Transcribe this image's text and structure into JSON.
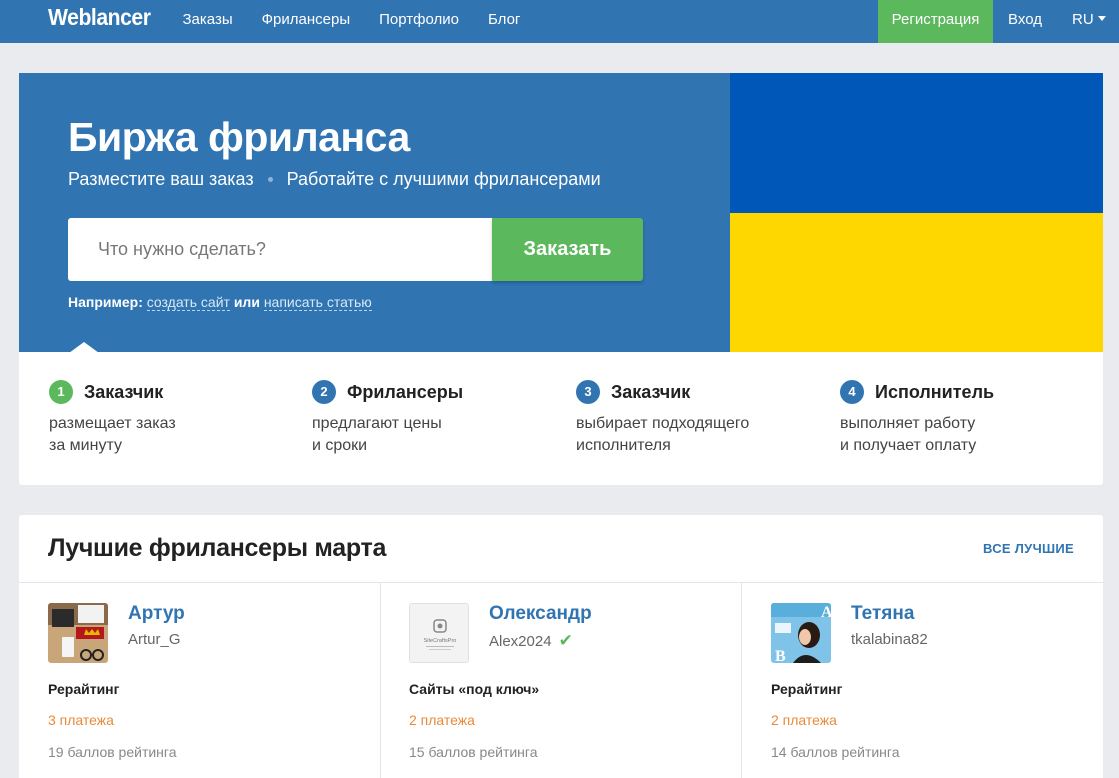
{
  "nav": {
    "logo": "Weblancer",
    "links": [
      "Заказы",
      "Фрилансеры",
      "Портфолио",
      "Блог"
    ],
    "register": "Регистрация",
    "login": "Вход",
    "lang": "RU"
  },
  "hero": {
    "title": "Биржа фриланса",
    "sub1": "Разместите ваш заказ",
    "sub2": "Работайте с лучшими фрилансерами",
    "search_placeholder": "Что нужно сделать?",
    "order_button": "Заказать",
    "example_prefix": "Например:",
    "example_link1": "создать сайт",
    "example_or": "или",
    "example_link2": "написать статью"
  },
  "flag": {
    "top_color": "#0057b8",
    "bottom_color": "#ffd700"
  },
  "steps": [
    {
      "num": "1",
      "title": "Заказчик",
      "desc": "размещает заказ\nза минуту",
      "color": "#5cb85c"
    },
    {
      "num": "2",
      "title": "Фрилансеры",
      "desc": "предлагают цены\nи сроки",
      "color": "#3074b2"
    },
    {
      "num": "3",
      "title": "Заказчик",
      "desc": "выбирает подходящего\nисполнителя",
      "color": "#3074b2"
    },
    {
      "num": "4",
      "title": "Исполнитель",
      "desc": "выполняет работу\nи получает оплату",
      "color": "#3074b2"
    }
  ],
  "best": {
    "title": "Лучшие фрилансеры марта",
    "all_link": "ВСЕ ЛУЧШИЕ",
    "freelancers": [
      {
        "name": "Артур",
        "login": "Artur_G",
        "verified": false,
        "spec": "Рерайтинг",
        "payments": "3 платежа",
        "score": "19 баллов рейтинга"
      },
      {
        "name": "Олександр",
        "login": "Alex2024",
        "verified": true,
        "spec": "Сайты «под ключ»",
        "payments": "2 платежа",
        "score": "15 баллов рейтинга",
        "avatar_text": "SiteCraftsPro"
      },
      {
        "name": "Тетяна",
        "login": "tkalabina82",
        "verified": false,
        "spec": "Рерайтинг",
        "payments": "2 платежа",
        "score": "14 баллов рейтинга"
      }
    ]
  },
  "colors": {
    "brand_blue": "#3074b2",
    "accent_green": "#5cb85c",
    "payments_orange": "#e88a3a"
  }
}
